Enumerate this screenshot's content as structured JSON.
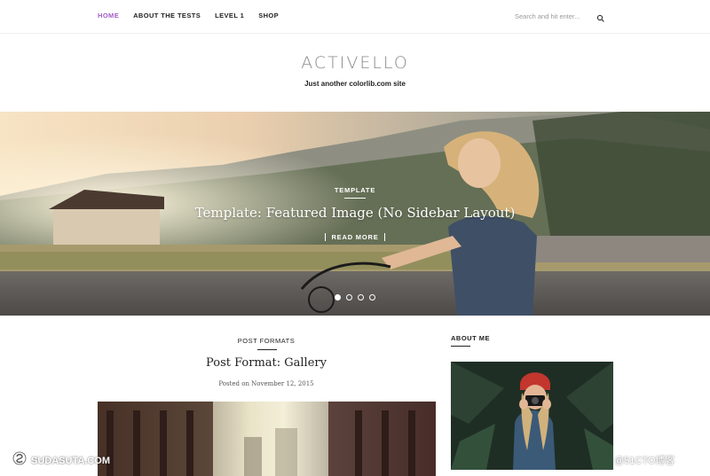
{
  "nav": {
    "items": [
      {
        "label": "HOME",
        "active": true
      },
      {
        "label": "ABOUT THE TESTS",
        "active": false
      },
      {
        "label": "LEVEL 1",
        "active": false
      },
      {
        "label": "SHOP",
        "active": false
      }
    ],
    "search_placeholder": "Search and hit enter...",
    "search_icon": "search-icon"
  },
  "site": {
    "title": "ACTIVELLO",
    "tagline": "Just another colorlib.com site"
  },
  "hero": {
    "category": "TEMPLATE",
    "title": "Template: Featured Image (No Sidebar Layout)",
    "read_more": "READ MORE",
    "slide_count": 4,
    "active_slide": 1
  },
  "post": {
    "category": "POST FORMATS",
    "title": "Post Format: Gallery",
    "meta": "Posted on November 12, 2015"
  },
  "sidebar": {
    "widget_title": "ABOUT ME"
  },
  "watermarks": {
    "left": "SUDASUTA.COM",
    "right": "@51CTO博客"
  },
  "colors": {
    "accent": "#a05cc5",
    "text": "#222222",
    "muted": "#8a8a8a"
  }
}
